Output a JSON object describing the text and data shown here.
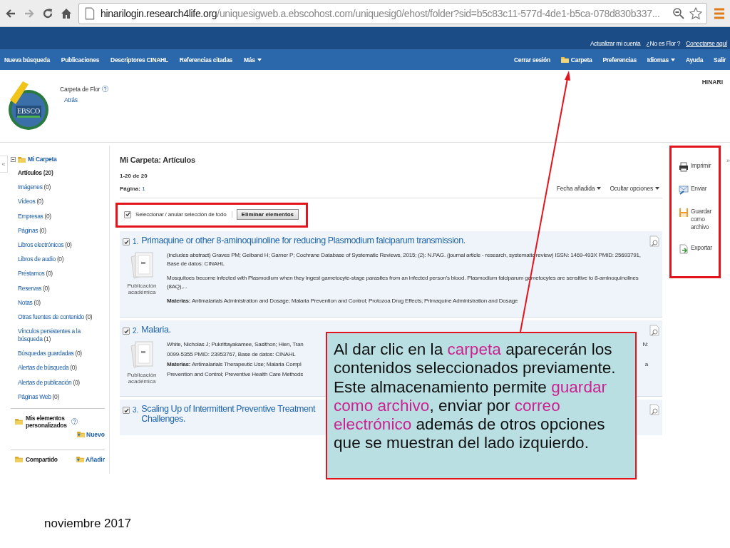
{
  "browser": {
    "url_host": "hinarilogin.research4life.org",
    "url_rest": "/uniquesigweb.a.ebscohost.com/uniquesig0/ehost/folder?sid=b5c83c11-577d-4de1-b5ca-078d830b337..."
  },
  "top_bar": {
    "links": [
      {
        "label": "Actualizar mi cuenta",
        "kind": "plain"
      },
      {
        "label": "¿No es Flor ?",
        "kind": "plain"
      },
      {
        "label": "Conectarse aquí",
        "kind": "underlined"
      }
    ]
  },
  "nav_left": [
    {
      "label": "Nueva búsqueda",
      "dropdown": false
    },
    {
      "label": "Publicaciones",
      "dropdown": false
    },
    {
      "label": "Descriptores CINAHL",
      "dropdown": false
    },
    {
      "label": "Referencias citadas",
      "dropdown": false
    },
    {
      "label": "Más",
      "dropdown": true
    }
  ],
  "nav_right": [
    {
      "label": "Cerrar sesión",
      "kind": "link",
      "dropdown": false
    },
    {
      "label": "Carpeta",
      "kind": "folder",
      "dropdown": false
    },
    {
      "label": "Preferencias",
      "kind": "link",
      "dropdown": false
    },
    {
      "label": "Idiomas",
      "kind": "link",
      "dropdown": true
    },
    {
      "label": "Ayuda",
      "kind": "link",
      "dropdown": false
    },
    {
      "label": "Salir",
      "kind": "link",
      "dropdown": false
    }
  ],
  "header": {
    "logo_text": "EBSCO",
    "folder_title": "Carpeta de Flor",
    "back": "Atrás",
    "institution": "HINARI"
  },
  "sidebar": {
    "collapse": "«",
    "folder": "Mi Carpeta",
    "items": [
      {
        "label": "Artículos",
        "count": "(20)",
        "selected": true
      },
      {
        "label": "Imágenes",
        "count": "(0)",
        "selected": false
      },
      {
        "label": "Vídeos",
        "count": "(0)",
        "selected": false
      },
      {
        "label": "Empresas",
        "count": "(0)",
        "selected": false
      },
      {
        "label": "Páginas",
        "count": "(0)",
        "selected": false
      },
      {
        "label": "Libros electrónicos",
        "count": "(0)",
        "selected": false
      },
      {
        "label": "Libros de audio",
        "count": "(0)",
        "selected": false
      },
      {
        "label": "Préstamos",
        "count": "(0)",
        "selected": false
      },
      {
        "label": "Reservas",
        "count": "(0)",
        "selected": false
      },
      {
        "label": "Notas",
        "count": "(0)",
        "selected": false
      },
      {
        "label": "Otras fuentes de contenido",
        "count": "(0)",
        "selected": false
      },
      {
        "label": "Vínculos persistentes a la búsqueda",
        "count": "(1)",
        "selected": false
      },
      {
        "label": "Búsquedas guardadas",
        "count": "(0)",
        "selected": false
      },
      {
        "label": "Alertas de búsqueda",
        "count": "(0)",
        "selected": false
      },
      {
        "label": "Alertas de publicación",
        "count": "(0)",
        "selected": false
      },
      {
        "label": "Páginas Web",
        "count": "(0)",
        "selected": false
      }
    ],
    "custom": {
      "label": "Mis elementos personalizados",
      "action": "Nuevo"
    },
    "shared": {
      "label": "Compartido",
      "action": "Añadir"
    }
  },
  "main": {
    "title": "Mi Carpeta: Artículos",
    "range": "1-20 de 20",
    "page_label": "Página:",
    "page": "1",
    "sort": "Fecha añadida",
    "options": "Ocultar opciones",
    "select_all": {
      "label": "Seleccionar / anular selección de todo",
      "checked": true
    },
    "delete_button": "Eliminar elementos"
  },
  "results": [
    {
      "number": "1.",
      "checked": true,
      "title_lines": [
        "Primaquine or other 8-aminoquinoline for reducing Plasmodium falciparum transmission."
      ],
      "type_lines": [
        "Publicación",
        "académica"
      ],
      "lines": [
        {
          "text": "(includes abstract) Graves PM; Gelband H; Garner P; Cochrane Database of Systematic Reviews, 2015; (2): N.PAG. (journal article - research, systematic review) ISSN: 1469-493X PMID: 25693791, Base de datos: CINAHL"
        },
        {
          "text": "Mosquitoes become infected with Plasmodium when they ingest gametocyte-stage parasites from an infected person's blood. Plasmodium falciparum gametocytes are sensitive to 8-aminoquinolines (8AQ),..."
        },
        {
          "text": "**Materias:** Antimalarials Administration and Dosage; Malaria Prevention and Control; Protozoa Drug Effects; Primaquine Administration and Dosage"
        }
      ]
    },
    {
      "number": "2.",
      "checked": true,
      "title_lines": [
        "Malaria."
      ],
      "type_lines": [
        "Publicación",
        "académica"
      ],
      "lines": [
        {
          "text": "White, Nicholas J; Pukrittayakamee, Sasithon; Hien, Tran",
          "right": "N:"
        },
        {
          "text": "0099-5355 PMID: 23953767, Base de datos: CINAHL"
        },
        {
          "text": "**Materias:** Antimalarials Therapeutic Use; Malaria Compl",
          "right": "a"
        },
        {
          "text": "Prevention and Control; Preventive Health Care Methods"
        }
      ]
    },
    {
      "number": "3.",
      "checked": true,
      "title_lines": [
        "Scaling Up of Intermittent Preventive Treatment",
        "Challenges."
      ]
    }
  ],
  "tools": {
    "expand": "»",
    "items": [
      {
        "label": "Imprimir",
        "kind": "print"
      },
      {
        "label": "Enviar",
        "kind": "email"
      },
      {
        "label": "Guardar como archivo",
        "kind": "save"
      },
      {
        "label": "Exportar",
        "kind": "export"
      }
    ]
  },
  "callout": {
    "segments": [
      {
        "text": "Al dar clic en la ",
        "highlight": false
      },
      {
        "text": "carpeta",
        "highlight": true
      },
      {
        "text": " aparecerán los contenidos seleccionados previamente. Este almacenamiento permite ",
        "highlight": false
      },
      {
        "text": "guardar como archivo",
        "highlight": true
      },
      {
        "text": ", enviar por ",
        "highlight": false
      },
      {
        "text": "correo electrónico",
        "highlight": true
      },
      {
        "text": " además de otros opciones que se muestran del lado izquierdo.",
        "highlight": false
      }
    ]
  },
  "footer": {
    "date": "noviembre 2017"
  }
}
